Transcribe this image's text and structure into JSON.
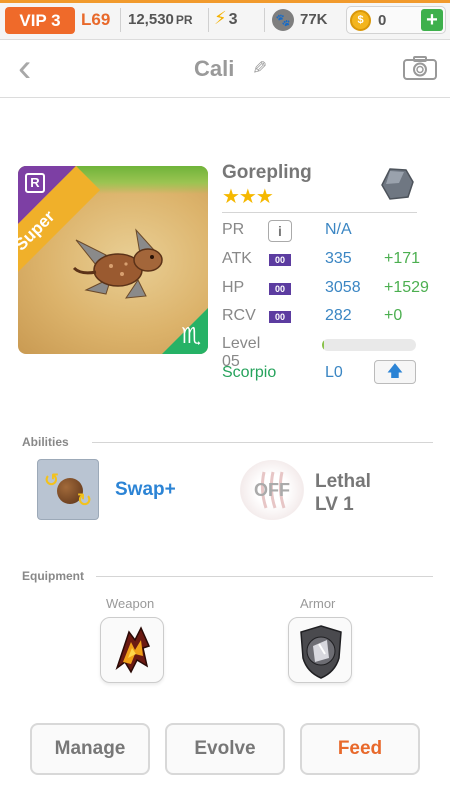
{
  "topbar": {
    "vip": "VIP 3",
    "level": "L69",
    "pr_value": "12,530",
    "pr_unit": "PR",
    "energy": "3",
    "paws": "77K",
    "coins": "0",
    "add_label": "+"
  },
  "header": {
    "name": "Cali",
    "back_glyph": "‹"
  },
  "monster": {
    "rarity_badge": "R",
    "ribbon": "Super",
    "zodiac_glyph": "♏",
    "species": "Gorepling",
    "stars": "★★★",
    "stats": [
      {
        "label": "PR",
        "tag": "i",
        "value": "N/A",
        "bonus": ""
      },
      {
        "label": "ATK",
        "tag": "00",
        "value": "335",
        "bonus": "+171"
      },
      {
        "label": "HP",
        "tag": "00",
        "value": "3058",
        "bonus": "+1529"
      },
      {
        "label": "RCV",
        "tag": "00",
        "value": "282",
        "bonus": "+0"
      }
    ],
    "level_label": "Level 05",
    "level_progress": 0.02,
    "zodiac_name": "Scorpio",
    "zodiac_level": "L0",
    "upgrade_glyph": "🡅"
  },
  "abilities": {
    "heading": "Abilities",
    "active_name": "Swap+",
    "passive_state": "OFF",
    "passive_name": "Lethal",
    "passive_level": "LV 1"
  },
  "equipment": {
    "heading": "Equipment",
    "weapon_label": "Weapon",
    "armor_label": "Armor"
  },
  "actions": {
    "manage": "Manage",
    "evolve": "Evolve",
    "feed": "Feed"
  },
  "colors": {
    "accent_orange": "#ef6a2a",
    "link_blue": "#2c84d5",
    "bonus_green": "#4caf50",
    "zodiac_green": "#26a35c",
    "star_gold": "#f5b800"
  }
}
